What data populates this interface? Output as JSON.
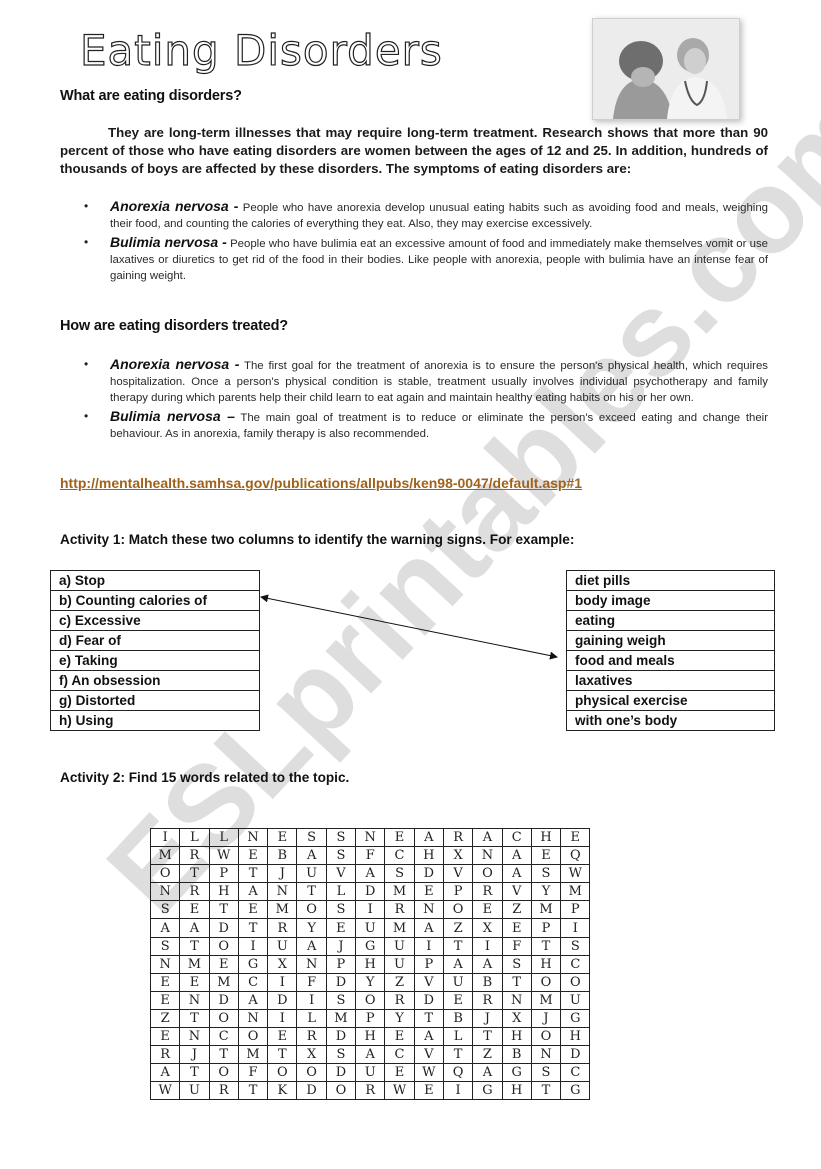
{
  "title": "Eating Disorders",
  "photo_alt": "patient-with-doctor-photo",
  "section1": {
    "heading": "What are eating disorders?",
    "paragraph": "They are long-term illnesses that may require long-term treatment. Research shows that more than 90 percent of those who have eating disorders are women between the ages of 12 and 25. In addition, hundreds of thousands of boys are affected by these disorders. The symptoms of eating disorders are:",
    "items": [
      {
        "term": "Anorexia nervosa -",
        "text": " People who have anorexia develop unusual eating habits such as avoiding food and meals, weighing their food, and counting the calories of everything they eat. Also, they may exercise excessively."
      },
      {
        "term": "Bulimia nervosa -",
        "text": " People who have bulimia eat an excessive amount of food and immediately make themselves vomit or use laxatives or diuretics to get rid of the food in their bodies. Like people with anorexia, people with bulimia have an intense fear of gaining weight."
      }
    ]
  },
  "section2": {
    "heading": "How are eating disorders treated?",
    "items": [
      {
        "term": "Anorexia nervosa -",
        "text": " The first goal for the treatment of anorexia is to ensure the person's physical health, which requires hospitalization. Once a person's physical condition is stable, treatment usually involves individual psychotherapy and family therapy during which parents help their child learn to eat again and maintain healthy eating habits on his or her own."
      },
      {
        "term": "Bulimia nervosa –",
        "text": " The main goal of treatment is to reduce or eliminate the person's exceed eating and change their behaviour. As in anorexia, family therapy is also recommended."
      }
    ]
  },
  "source_link": "http://mentalhealth.samhsa.gov/publications/allpubs/ken98-0047/default.asp#1",
  "activity1": {
    "instruction": "Activity 1: Match these two columns to identify the warning signs. For example:",
    "left": [
      "a) Stop",
      "b) Counting calories of",
      "c) Excessive",
      "d) Fear of",
      "e) Taking",
      "f) An obsession",
      "g) Distorted",
      "h) Using"
    ],
    "right": [
      "diet pills",
      "body image",
      "eating",
      "gaining weigh",
      " food and meals",
      "laxatives",
      "physical exercise",
      "with one’s body"
    ],
    "example_match": {
      "from": "b) Counting calories of",
      "to": " food and meals"
    }
  },
  "activity2": {
    "instruction": "Activity 2: Find 15 words related to the topic.",
    "grid": [
      [
        "I",
        "L",
        "L",
        "N",
        "E",
        "S",
        "S",
        "N",
        "E",
        "A",
        "R",
        "A",
        "C",
        "H",
        "E"
      ],
      [
        "M",
        "R",
        "W",
        "E",
        "B",
        "A",
        "S",
        "F",
        "C",
        "H",
        "X",
        "N",
        "A",
        "E",
        "Q"
      ],
      [
        "O",
        "T",
        "P",
        "T",
        "J",
        "U",
        "V",
        "A",
        "S",
        "D",
        "V",
        "O",
        "A",
        "S",
        "W"
      ],
      [
        "N",
        "R",
        "H",
        "A",
        "N",
        "T",
        "L",
        "D",
        "M",
        "E",
        "P",
        "R",
        "V",
        "Y",
        "M"
      ],
      [
        "S",
        "E",
        "T",
        "E",
        "M",
        "O",
        "S",
        "I",
        "R",
        "N",
        "O",
        "E",
        "Z",
        "M",
        "P"
      ],
      [
        "A",
        "A",
        "D",
        "T",
        "R",
        "Y",
        "E",
        "U",
        "M",
        "A",
        "Z",
        "X",
        "E",
        "P",
        "I"
      ],
      [
        "S",
        "T",
        "O",
        "I",
        "U",
        "A",
        "J",
        "G",
        "U",
        "I",
        "T",
        "I",
        "F",
        "T",
        "S"
      ],
      [
        "N",
        "M",
        "E",
        "G",
        "X",
        "N",
        "P",
        "H",
        "U",
        "P",
        "A",
        "A",
        "S",
        "H",
        "C"
      ],
      [
        "E",
        "E",
        "M",
        "C",
        "I",
        "F",
        "D",
        "Y",
        "Z",
        "V",
        "U",
        "B",
        "T",
        "O",
        "O"
      ],
      [
        "E",
        "N",
        "D",
        "A",
        "D",
        "I",
        "S",
        "O",
        "R",
        "D",
        "E",
        "R",
        "N",
        "M",
        "U"
      ],
      [
        "Z",
        "T",
        "O",
        "N",
        "I",
        "L",
        "M",
        "P",
        "Y",
        "T",
        "B",
        "J",
        "X",
        "J",
        "G"
      ],
      [
        "E",
        "N",
        "C",
        "O",
        "E",
        "R",
        "D",
        "H",
        "E",
        "A",
        "L",
        "T",
        "H",
        "O",
        "H"
      ],
      [
        "R",
        "J",
        "T",
        "M",
        "T",
        "X",
        "S",
        "A",
        "C",
        "V",
        "T",
        "Z",
        "B",
        "N",
        "D"
      ],
      [
        "A",
        "T",
        "O",
        "F",
        "O",
        "O",
        "D",
        "U",
        "E",
        "W",
        "Q",
        "A",
        "G",
        "S",
        "C"
      ],
      [
        "W",
        "U",
        "R",
        "T",
        "K",
        "D",
        "O",
        "R",
        "W",
        "E",
        "I",
        "G",
        "H",
        "T",
        "G"
      ]
    ]
  },
  "watermark": "ESLprintables.com",
  "colors": {
    "link": "#a0621b",
    "watermark": "#c4c4c4"
  }
}
